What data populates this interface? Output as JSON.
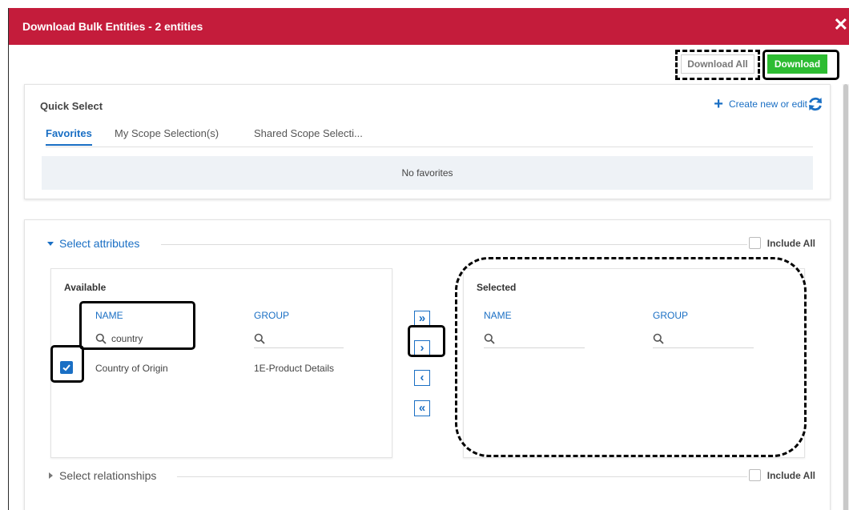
{
  "dialog": {
    "title": "Download Bulk Entities - 2 entities",
    "close_glyph": "✕"
  },
  "actions": {
    "download_all_label": "Download All",
    "download_label": "Download"
  },
  "quick_select": {
    "title": "Quick Select",
    "create_label": "Create new or edit",
    "create_icon": "plus-icon",
    "refresh_icon": "refresh-icon",
    "tabs": [
      {
        "label": "Favorites",
        "active": true
      },
      {
        "label": "My Scope Selection(s)",
        "active": false
      },
      {
        "label": "Shared Scope Selecti...",
        "active": false
      }
    ],
    "empty_message": "No favorites"
  },
  "attributes": {
    "section_label": "Select attributes",
    "expanded": true,
    "include_all_label": "Include All",
    "include_all_checked": false,
    "available": {
      "title": "Available",
      "col_name": "NAME",
      "col_group": "GROUP",
      "name_filter": "country",
      "group_filter": "",
      "rows": [
        {
          "name": "Country of Origin",
          "group": "1E-Product Details",
          "checked": true
        }
      ]
    },
    "transfer_buttons": [
      {
        "glyph": "»",
        "action": "move-all-right"
      },
      {
        "glyph": "›",
        "action": "move-right"
      },
      {
        "glyph": "‹",
        "action": "move-left"
      },
      {
        "glyph": "«",
        "action": "move-all-left"
      }
    ],
    "selected": {
      "title": "Selected",
      "col_name": "NAME",
      "col_group": "GROUP",
      "name_filter": "",
      "group_filter": ""
    }
  },
  "relationships": {
    "section_label": "Select relationships",
    "expanded": false,
    "include_all_label": "Include All",
    "include_all_checked": false
  },
  "colors": {
    "title_bar": "#c41c3b",
    "download_button": "#2dbc32",
    "accent_blue": "#1a6fc4",
    "empty_bg": "#eef2f6"
  }
}
